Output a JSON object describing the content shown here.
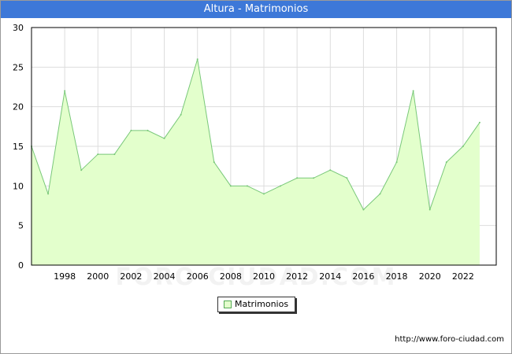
{
  "chart_data": {
    "type": "area",
    "title": "Altura - Matrimonios",
    "x": [
      1996,
      1997,
      1998,
      1999,
      2000,
      2001,
      2002,
      2003,
      2004,
      2005,
      2006,
      2007,
      2008,
      2009,
      2010,
      2011,
      2012,
      2013,
      2014,
      2015,
      2016,
      2017,
      2018,
      2019,
      2020,
      2021,
      2022,
      2023
    ],
    "series": [
      {
        "name": "Matrimonios",
        "values": [
          15,
          9,
          22,
          12,
          14,
          14,
          17,
          17,
          16,
          19,
          26,
          13,
          10,
          10,
          9,
          10,
          11,
          11,
          12,
          11,
          7,
          9,
          13,
          22,
          7,
          13,
          15,
          18
        ]
      }
    ],
    "xlim": [
      1996,
      2024
    ],
    "ylim": [
      0,
      30
    ],
    "x_ticks": [
      1998,
      2000,
      2002,
      2004,
      2006,
      2008,
      2010,
      2012,
      2014,
      2016,
      2018,
      2020,
      2022
    ],
    "y_ticks": [
      0,
      5,
      10,
      15,
      20,
      25,
      30
    ],
    "grid": true,
    "legend_position": "bottom-center",
    "colors": {
      "fill": "#e3ffcc",
      "line": "#79c879",
      "grid": "#dddddd",
      "title_bar": "#3d78d8"
    }
  },
  "watermark": "FORO-CIUDAD.COM",
  "source_url": "http://www.foro-ciudad.com"
}
